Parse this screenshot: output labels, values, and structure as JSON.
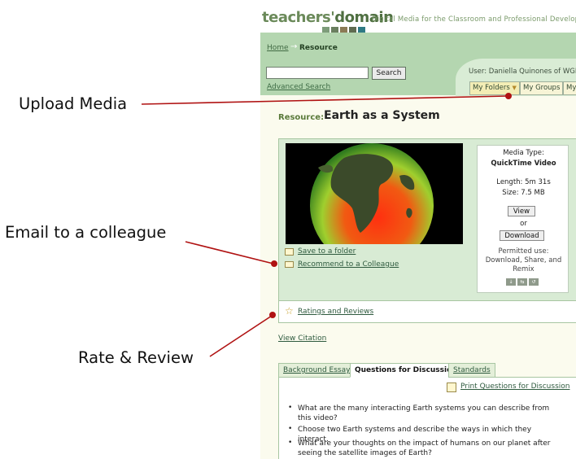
{
  "callouts": {
    "upload": "Upload Media",
    "email": "Email to a colleague",
    "rate": "Rate & Review"
  },
  "header": {
    "logo_part1": "teachers'",
    "logo_part2": "domain",
    "tagline": "Digital Media for the Classroom and Professional Development"
  },
  "breadcrumb": {
    "home": "Home",
    "arrow": "→",
    "current": "Resource"
  },
  "search": {
    "value": "",
    "button": "Search",
    "advanced": "Advanced Search"
  },
  "user": {
    "label": "User: Daniella Quinones of WGBH",
    "tabs": [
      "My Folders",
      "My Groups",
      "My"
    ]
  },
  "resource": {
    "label": "Resource:",
    "title": "Earth as a System",
    "save": "Save to a folder",
    "recommend": "Recommend to a Colleague",
    "media_type_label": "Media Type:",
    "media_type": "QuickTime Video",
    "length": "Length: 5m 31s",
    "size": "Size: 7.5 MB",
    "view": "View",
    "or": "or",
    "download": "Download",
    "permitted": "Permitted use: Download, Share, and Remix",
    "ratings": "Ratings and Reviews",
    "citation": "View Citation"
  },
  "tabs": [
    "Background Essay",
    "Questions for Discussion",
    "Standards"
  ],
  "print": "Print Questions for Discussion",
  "questions": [
    "What are the many interacting Earth systems you can describe from this video?",
    "Choose two Earth systems and describe the ways in which they interact.",
    "What are your thoughts on the impact of humans on our planet after seeing the satellite images of Earth?"
  ],
  "colors": {
    "nav_green": "#b4d6b0",
    "panel_bg": "#fbfbee",
    "arrow_red": "#b01212"
  }
}
